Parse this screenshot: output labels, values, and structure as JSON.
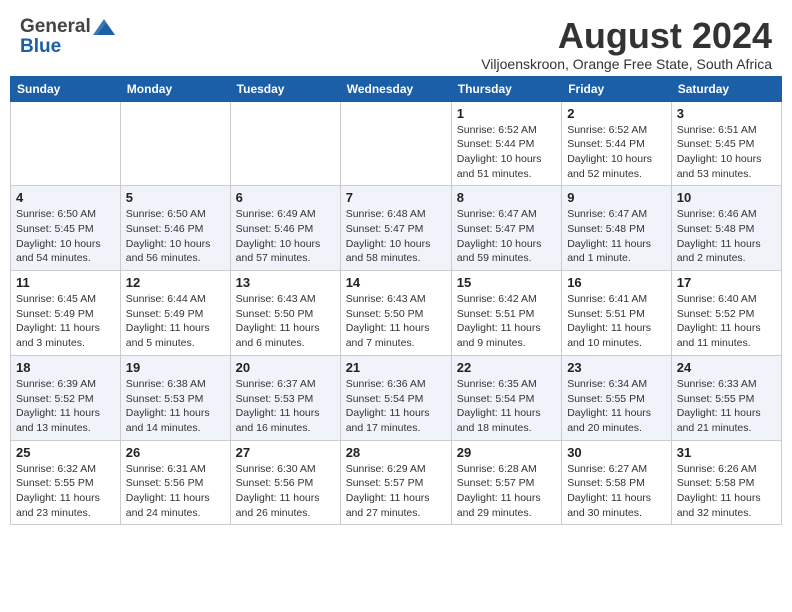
{
  "header": {
    "logo_general": "General",
    "logo_blue": "Blue",
    "main_title": "August 2024",
    "subtitle": "Viljoenskroon, Orange Free State, South Africa"
  },
  "columns": [
    "Sunday",
    "Monday",
    "Tuesday",
    "Wednesday",
    "Thursday",
    "Friday",
    "Saturday"
  ],
  "weeks": [
    [
      {
        "day": "",
        "info": ""
      },
      {
        "day": "",
        "info": ""
      },
      {
        "day": "",
        "info": ""
      },
      {
        "day": "",
        "info": ""
      },
      {
        "day": "1",
        "info": "Sunrise: 6:52 AM\nSunset: 5:44 PM\nDaylight: 10 hours\nand 51 minutes."
      },
      {
        "day": "2",
        "info": "Sunrise: 6:52 AM\nSunset: 5:44 PM\nDaylight: 10 hours\nand 52 minutes."
      },
      {
        "day": "3",
        "info": "Sunrise: 6:51 AM\nSunset: 5:45 PM\nDaylight: 10 hours\nand 53 minutes."
      }
    ],
    [
      {
        "day": "4",
        "info": "Sunrise: 6:50 AM\nSunset: 5:45 PM\nDaylight: 10 hours\nand 54 minutes."
      },
      {
        "day": "5",
        "info": "Sunrise: 6:50 AM\nSunset: 5:46 PM\nDaylight: 10 hours\nand 56 minutes."
      },
      {
        "day": "6",
        "info": "Sunrise: 6:49 AM\nSunset: 5:46 PM\nDaylight: 10 hours\nand 57 minutes."
      },
      {
        "day": "7",
        "info": "Sunrise: 6:48 AM\nSunset: 5:47 PM\nDaylight: 10 hours\nand 58 minutes."
      },
      {
        "day": "8",
        "info": "Sunrise: 6:47 AM\nSunset: 5:47 PM\nDaylight: 10 hours\nand 59 minutes."
      },
      {
        "day": "9",
        "info": "Sunrise: 6:47 AM\nSunset: 5:48 PM\nDaylight: 11 hours\nand 1 minute."
      },
      {
        "day": "10",
        "info": "Sunrise: 6:46 AM\nSunset: 5:48 PM\nDaylight: 11 hours\nand 2 minutes."
      }
    ],
    [
      {
        "day": "11",
        "info": "Sunrise: 6:45 AM\nSunset: 5:49 PM\nDaylight: 11 hours\nand 3 minutes."
      },
      {
        "day": "12",
        "info": "Sunrise: 6:44 AM\nSunset: 5:49 PM\nDaylight: 11 hours\nand 5 minutes."
      },
      {
        "day": "13",
        "info": "Sunrise: 6:43 AM\nSunset: 5:50 PM\nDaylight: 11 hours\nand 6 minutes."
      },
      {
        "day": "14",
        "info": "Sunrise: 6:43 AM\nSunset: 5:50 PM\nDaylight: 11 hours\nand 7 minutes."
      },
      {
        "day": "15",
        "info": "Sunrise: 6:42 AM\nSunset: 5:51 PM\nDaylight: 11 hours\nand 9 minutes."
      },
      {
        "day": "16",
        "info": "Sunrise: 6:41 AM\nSunset: 5:51 PM\nDaylight: 11 hours\nand 10 minutes."
      },
      {
        "day": "17",
        "info": "Sunrise: 6:40 AM\nSunset: 5:52 PM\nDaylight: 11 hours\nand 11 minutes."
      }
    ],
    [
      {
        "day": "18",
        "info": "Sunrise: 6:39 AM\nSunset: 5:52 PM\nDaylight: 11 hours\nand 13 minutes."
      },
      {
        "day": "19",
        "info": "Sunrise: 6:38 AM\nSunset: 5:53 PM\nDaylight: 11 hours\nand 14 minutes."
      },
      {
        "day": "20",
        "info": "Sunrise: 6:37 AM\nSunset: 5:53 PM\nDaylight: 11 hours\nand 16 minutes."
      },
      {
        "day": "21",
        "info": "Sunrise: 6:36 AM\nSunset: 5:54 PM\nDaylight: 11 hours\nand 17 minutes."
      },
      {
        "day": "22",
        "info": "Sunrise: 6:35 AM\nSunset: 5:54 PM\nDaylight: 11 hours\nand 18 minutes."
      },
      {
        "day": "23",
        "info": "Sunrise: 6:34 AM\nSunset: 5:55 PM\nDaylight: 11 hours\nand 20 minutes."
      },
      {
        "day": "24",
        "info": "Sunrise: 6:33 AM\nSunset: 5:55 PM\nDaylight: 11 hours\nand 21 minutes."
      }
    ],
    [
      {
        "day": "25",
        "info": "Sunrise: 6:32 AM\nSunset: 5:55 PM\nDaylight: 11 hours\nand 23 minutes."
      },
      {
        "day": "26",
        "info": "Sunrise: 6:31 AM\nSunset: 5:56 PM\nDaylight: 11 hours\nand 24 minutes."
      },
      {
        "day": "27",
        "info": "Sunrise: 6:30 AM\nSunset: 5:56 PM\nDaylight: 11 hours\nand 26 minutes."
      },
      {
        "day": "28",
        "info": "Sunrise: 6:29 AM\nSunset: 5:57 PM\nDaylight: 11 hours\nand 27 minutes."
      },
      {
        "day": "29",
        "info": "Sunrise: 6:28 AM\nSunset: 5:57 PM\nDaylight: 11 hours\nand 29 minutes."
      },
      {
        "day": "30",
        "info": "Sunrise: 6:27 AM\nSunset: 5:58 PM\nDaylight: 11 hours\nand 30 minutes."
      },
      {
        "day": "31",
        "info": "Sunrise: 6:26 AM\nSunset: 5:58 PM\nDaylight: 11 hours\nand 32 minutes."
      }
    ]
  ]
}
